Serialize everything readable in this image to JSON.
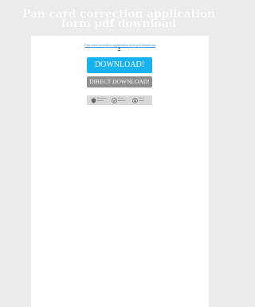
{
  "page": {
    "title": "Pan card correction application form pdf download"
  },
  "card": {
    "file_link_text": "Pan card correction application form pdf download",
    "user_icon": "user-icon",
    "download_button_label": "DOWNLOAD!",
    "direct_download_button_label": "DIRECT DOWNLOAD!",
    "badges": [
      {
        "icon": "shield-icon",
        "label": "Checked by antivirus"
      },
      {
        "icon": "check-shield-icon",
        "label": "Secure download"
      },
      {
        "icon": "lock-icon",
        "label": "Safe & private"
      }
    ]
  },
  "colors": {
    "background": "#ececec",
    "card": "#ffffff",
    "download_button": "#19b2f0",
    "direct_download_button": "#8f8f8f",
    "link": "#3a8fd8"
  }
}
